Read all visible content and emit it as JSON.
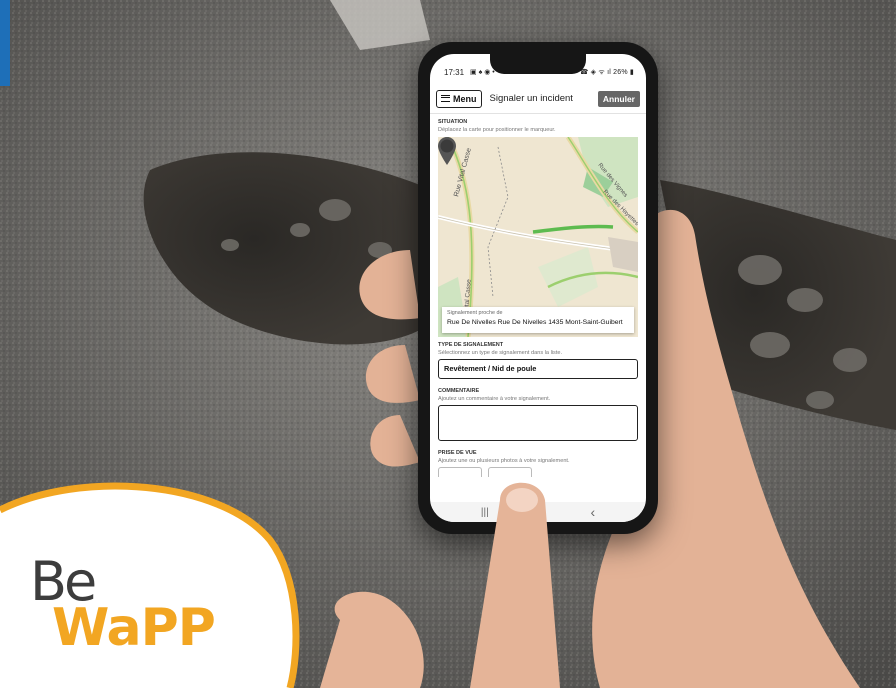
{
  "phone": {
    "status_bar": {
      "time": "17:31",
      "left_icons": "▣ ♠ ◉ •",
      "right_icons": "☎ ◈ ᯤ ıl 26% ▮"
    },
    "app_bar": {
      "menu_label": "Menu",
      "title": "Signaler un incident",
      "cancel_label": "Annuler"
    },
    "situation": {
      "heading": "SITUATION",
      "help": "Déplacez la carte pour positionner le marqueur.",
      "map_street_labels": [
        "Rue Vital Casse",
        "Rue des Vignes",
        "Rue des Hayettes",
        "Vital Casse"
      ],
      "nearby_caption": "Signalement proche de",
      "address": "Rue De Nivelles Rue De Nivelles 1435 Mont-Saint-Guibert"
    },
    "incident_type": {
      "heading": "TYPE DE SIGNALEMENT",
      "help": "Sélectionnez un type de signalement dans la liste.",
      "selected": "Revêtement / Nid de poule"
    },
    "comment": {
      "heading": "COMMENTAIRE",
      "help": "Ajoutez un commentaire à votre signalement."
    },
    "photo": {
      "heading": "PRISE DE VUE",
      "help": "Ajoutez une ou plusieurs photos à votre signalement."
    },
    "nav": {
      "recents": "|||",
      "back": "‹"
    }
  },
  "logo": {
    "line1": "Be",
    "line2": "WaPP",
    "accent_color": "#f2a622",
    "text_color": "#3d3d3d"
  },
  "colors": {
    "brand_blue": "#1e6fb8"
  }
}
